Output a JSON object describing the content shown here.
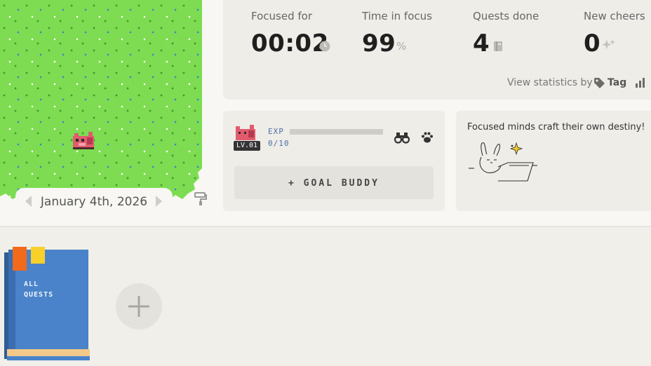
{
  "stats": {
    "focused_for": {
      "label": "Focused for",
      "value": "00:02",
      "icon": "clock-icon"
    },
    "time_in_focus": {
      "label": "Time in focus",
      "value": "99",
      "unit": "%"
    },
    "quests_done": {
      "label": "Quests done",
      "value": "4",
      "icon": "book-icon"
    },
    "new_cheers": {
      "label": "New cheers",
      "value": "0",
      "icon": "sparkle-icon"
    },
    "view_by_label": "View statistics by",
    "view_by_value": "Tag"
  },
  "calendar": {
    "date": "January 4th, 2026"
  },
  "pet": {
    "level": "LV.01",
    "exp_label": "EXP",
    "exp_count": "0/10",
    "exp_progress": 0,
    "goal_buddy_label": "+ GOAL BUDDY"
  },
  "quote": {
    "text": "Focused minds craft their own destiny!"
  },
  "notebooks": {
    "all_quests_label": "ALL\nQUESTS"
  },
  "colors": {
    "grass": "#7ddc52",
    "notebook_blue": "#4a83c9",
    "bookmark_orange": "#f26a1b",
    "bookmark_yellow": "#f8d02a",
    "exp_accent": "#4a6fa5"
  }
}
